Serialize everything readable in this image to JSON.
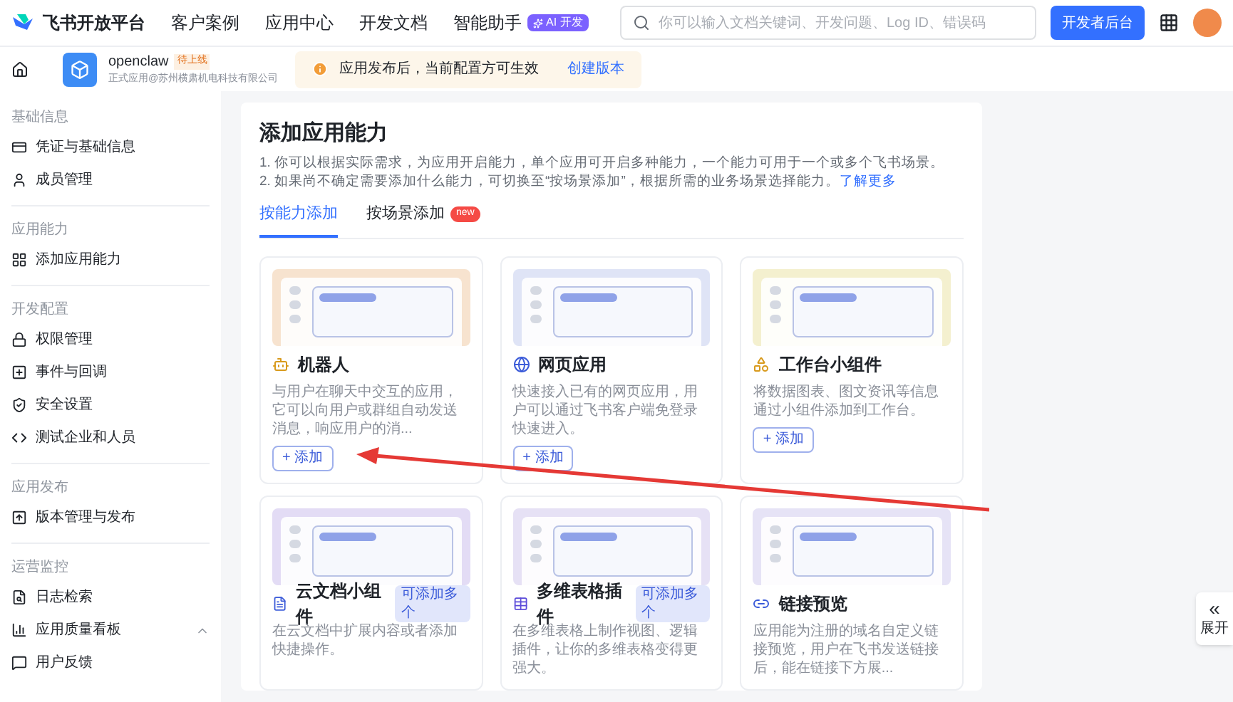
{
  "header": {
    "brand": "飞书开放平台",
    "nav": [
      {
        "label": "客户案例"
      },
      {
        "label": "应用中心"
      },
      {
        "label": "开发文档"
      },
      {
        "label": "智能助手",
        "badge": "AI 开发"
      }
    ],
    "search": {
      "placeholder": "你可以输入文档关键词、开发问题、Log ID、错误码"
    },
    "console_button": "开发者后台"
  },
  "app_bar": {
    "app_name": "openclaw",
    "status": "待上线",
    "subtitle": "正式应用@苏州横肃机电科技有限公司",
    "notice": "应用发布后，当前配置方可生效",
    "notice_link": "创建版本"
  },
  "sidebar": {
    "sections": [
      {
        "title": "基础信息",
        "items": [
          {
            "label": "凭证与基础信息"
          },
          {
            "label": "成员管理"
          }
        ]
      },
      {
        "title": "应用能力",
        "items": [
          {
            "label": "添加应用能力"
          }
        ]
      },
      {
        "title": "开发配置",
        "items": [
          {
            "label": "权限管理"
          },
          {
            "label": "事件与回调"
          },
          {
            "label": "安全设置"
          },
          {
            "label": "测试企业和人员"
          }
        ]
      },
      {
        "title": "应用发布",
        "items": [
          {
            "label": "版本管理与发布"
          }
        ]
      },
      {
        "title": "运营监控",
        "items": [
          {
            "label": "日志检索",
            "expandable": false
          },
          {
            "label": "应用质量看板",
            "expandable": true
          },
          {
            "label": "用户反馈",
            "expandable": false
          }
        ]
      }
    ]
  },
  "main": {
    "title": "添加应用能力",
    "notes": [
      "1. 你可以根据实际需求，为应用开启能力，单个应用可开启多种能力，一个能力可用于一个或多个飞书场景。",
      "2. 如果尚不确定需要添加什么能力，可切换至“按场景添加”，根据所需的业务场景选择能力。"
    ],
    "learn_more": "了解更多",
    "tabs": [
      {
        "label": "按能力添加",
        "selected": true
      },
      {
        "label": "按场景添加",
        "selected": false,
        "badge": "new"
      }
    ],
    "cards": [
      {
        "title": "机器人",
        "description": "与用户在聊天中交互的应用，它可以向用户或群组自动发送消息，响应用户的消...",
        "button": "+ 添加"
      },
      {
        "title": "网页应用",
        "description": "快速接入已有的网页应用，用户可以通过飞书客户端免登录快速进入。",
        "button": "+ 添加"
      },
      {
        "title": "工作台小组件",
        "description": "将数据图表、图文资讯等信息通过小组件添加到工作台。",
        "button": "+ 添加"
      },
      {
        "title": "云文档小组件",
        "badge": "可添加多个",
        "description": "在云文档中扩展内容或者添加快捷操作。"
      },
      {
        "title": "多维表格插件",
        "badge": "可添加多个",
        "description": "在多维表格上制作视图、逻辑插件，让你的多维表格变得更强大。"
      },
      {
        "title": "链接预览",
        "description": "应用能为注册的域名自定义链接预览，用户在飞书发送链接后，能在链接下方展..."
      }
    ]
  },
  "side_toggle": {
    "chevron": "«",
    "label": "展开"
  }
}
